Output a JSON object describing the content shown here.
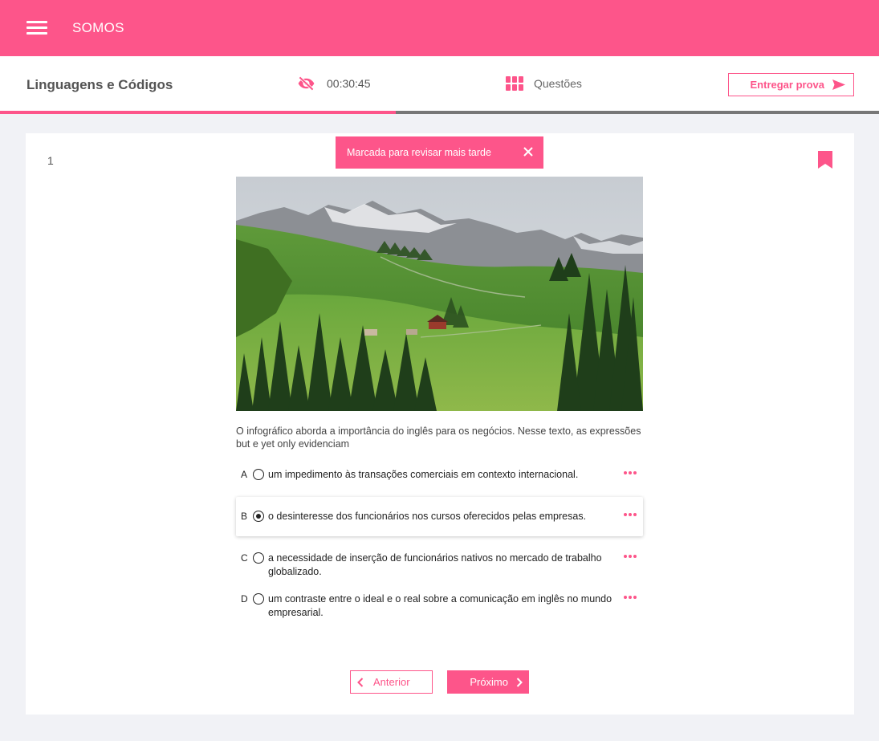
{
  "app": {
    "brand": "SOMOS"
  },
  "exam": {
    "subject": "Linguagens e Códigos",
    "timer": "00:30:45",
    "questions_label": "Questões",
    "submit_label": "Entregar prova",
    "progress": 0.45
  },
  "question": {
    "number": "1",
    "toast": "Marcada para revisar mais tarde",
    "text": "O infográfico aborda a importância do inglês para os negócios. Nesse texto, as expressões but e yet only evidenciam",
    "options": [
      {
        "letter": "A",
        "text": "um impedimento às transações comerciais em contexto internacional.",
        "selected": false
      },
      {
        "letter": "B",
        "text": "o desinteresse dos funcionários nos cursos oferecidos pelas empresas.",
        "selected": true
      },
      {
        "letter": "C",
        "text": "a necessidade de inserção de funcionários nativos no mercado de trabalho globalizado.",
        "selected": false
      },
      {
        "letter": "D",
        "text": "um contraste entre o ideal e o real sobre a comunicação em inglês no mundo empresarial.",
        "selected": false
      }
    ]
  },
  "nav": {
    "prev_label": "Anterior",
    "next_label": "Próximo"
  },
  "colors": {
    "accent": "#fd558a",
    "background": "#f1f2f6"
  },
  "icons": [
    "menu-icon",
    "eye-off-icon",
    "grid-icon",
    "send-icon",
    "bookmark-icon",
    "close-icon",
    "more-horizontal-icon",
    "chevron-left-icon",
    "chevron-right-icon"
  ]
}
